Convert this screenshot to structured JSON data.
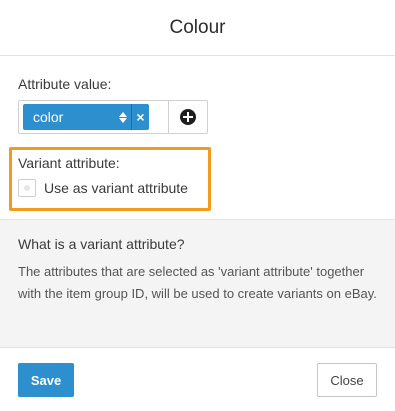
{
  "dialog": {
    "title": "Colour"
  },
  "attribute": {
    "label": "Attribute value:",
    "selected_value": "color",
    "clear_glyph": "×",
    "add_icon": "plus-circle-icon",
    "accent_color": "#2e8fcf"
  },
  "variant": {
    "label": "Variant attribute:",
    "checkbox_label": "Use as variant attribute",
    "checked": false,
    "highlight_color": "#f29b1f"
  },
  "info": {
    "title": "What is a variant attribute?",
    "text": "The attributes that are selected as 'variant attribute' together with the item group ID, will be used to create variants on eBay."
  },
  "footer": {
    "save_label": "Save",
    "close_label": "Close"
  }
}
